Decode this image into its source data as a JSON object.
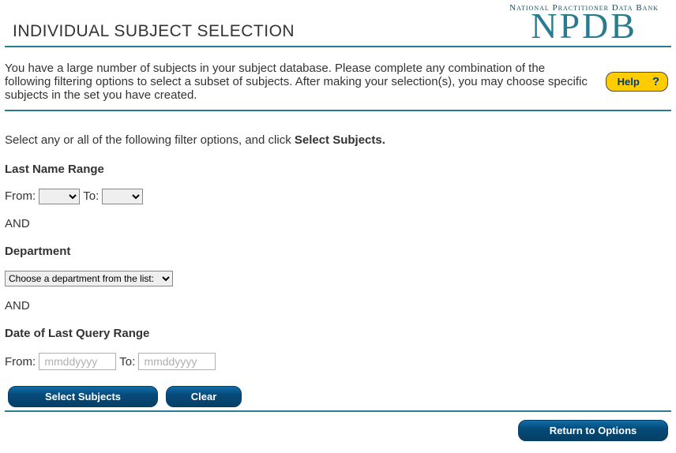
{
  "header": {
    "title": "INDIVIDUAL SUBJECT SELECTION",
    "brand_top": "National Practitioner Data Bank",
    "brand_bottom": "NPDB"
  },
  "intro": {
    "text": "You have a large number of subjects in your subject database. Please complete any combination of the following filtering options to select a subset of subjects. After making your selection(s), you may choose specific subjects in the set you have created.",
    "help_label": "Help",
    "help_q": "?"
  },
  "instruction": {
    "prefix": "Select any or all of the following filter options, and click ",
    "bold": "Select Subjects."
  },
  "lastname": {
    "label": "Last Name Range",
    "from_label": "From:",
    "to_label": "To:",
    "from_value": "",
    "to_value": ""
  },
  "and_text": "AND",
  "department": {
    "label": "Department",
    "selected": "Choose a department from the list:"
  },
  "lastquery": {
    "label": "Date of Last Query Range",
    "from_label": "From:",
    "to_label": "To:",
    "placeholder": "mmddyyyy",
    "from_value": "",
    "to_value": ""
  },
  "buttons": {
    "select_subjects": "Select Subjects",
    "clear": "Clear",
    "return": "Return to Options"
  }
}
